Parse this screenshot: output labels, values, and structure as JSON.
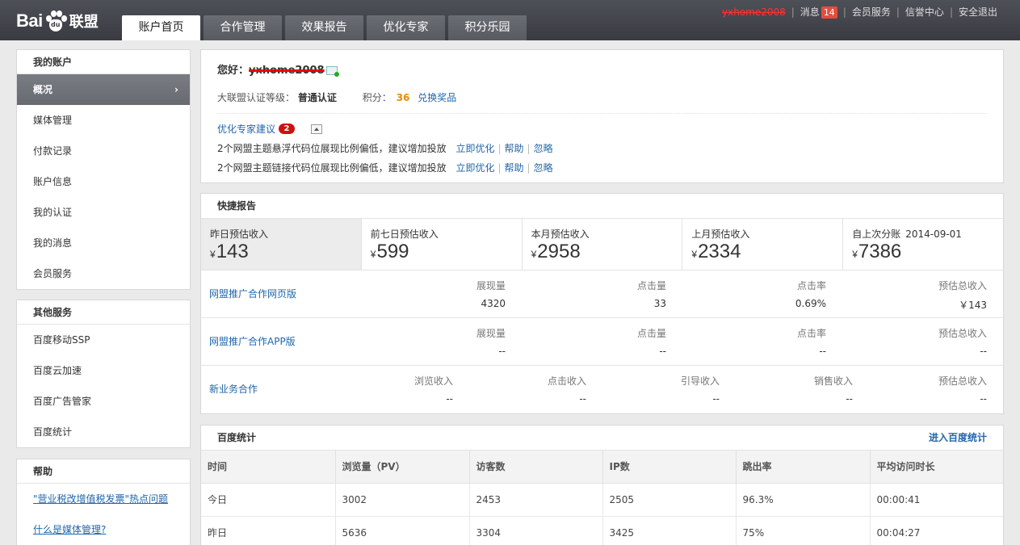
{
  "header": {
    "logo_bai": "Bai",
    "logo_du": "du",
    "logo_lianmeng": "联盟",
    "tabs": [
      {
        "label": "账户首页"
      },
      {
        "label": "合作管理"
      },
      {
        "label": "效果报告"
      },
      {
        "label": "优化专家"
      },
      {
        "label": "积分乐园"
      }
    ],
    "username": "yxhome2008",
    "messages_label": "消息",
    "messages_count": "14",
    "member_service": "会员服务",
    "credit_center": "信誉中心",
    "logout": "安全退出"
  },
  "sidebar": {
    "account": {
      "title": "我的账户",
      "items": [
        {
          "label": "概况"
        },
        {
          "label": "媒体管理"
        },
        {
          "label": "付款记录"
        },
        {
          "label": "账户信息"
        },
        {
          "label": "我的认证"
        },
        {
          "label": "我的消息"
        },
        {
          "label": "会员服务"
        }
      ]
    },
    "other": {
      "title": "其他服务",
      "items": [
        {
          "label": "百度移动SSP"
        },
        {
          "label": "百度云加速"
        },
        {
          "label": "百度广告管家"
        },
        {
          "label": "百度统计"
        }
      ]
    },
    "help": {
      "title": "帮助",
      "links": [
        {
          "label": "\"营业税改增值税发票\"热点问题"
        },
        {
          "label": "什么是媒体管理?"
        }
      ]
    }
  },
  "welcome": {
    "greeting": "您好：",
    "username": "yxhome2008",
    "cert_label": "大联盟认证等级：",
    "cert_value": "普通认证",
    "points_label": "积分：",
    "points_value": "36",
    "redeem": "兑换奖品",
    "advice_title": "优化专家建议",
    "advice_count": "2",
    "advice": [
      {
        "text": "2个网盟主题悬浮代码位展现比例偏低，建议增加投放",
        "action": "立即优化",
        "help": "帮助",
        "ignore": "忽略"
      },
      {
        "text": "2个网盟主题链接代码位展现比例偏低，建议增加投放",
        "action": "立即优化",
        "help": "帮助",
        "ignore": "忽略"
      }
    ]
  },
  "quick_report": {
    "title": "快捷报告",
    "currency": "¥",
    "stats": [
      {
        "label": "昨日预估收入",
        "value": "143",
        "date": ""
      },
      {
        "label": "前七日预估收入",
        "value": "599",
        "date": ""
      },
      {
        "label": "本月预估收入",
        "value": "2958",
        "date": ""
      },
      {
        "label": "上月预估收入",
        "value": "2334",
        "date": ""
      },
      {
        "label": "自上次分账",
        "value": "7386",
        "date": "2014-09-01"
      }
    ],
    "rows": [
      {
        "name": "网盟推广合作网页版",
        "cells": [
          {
            "h": "展现量",
            "v": "4320"
          },
          {
            "h": "点击量",
            "v": "33"
          },
          {
            "h": "点击率",
            "v": "0.69%"
          },
          {
            "h": "预估总收入",
            "v": "￥143"
          }
        ]
      },
      {
        "name": "网盟推广合作APP版",
        "cells": [
          {
            "h": "展现量",
            "v": "--"
          },
          {
            "h": "点击量",
            "v": "--"
          },
          {
            "h": "点击率",
            "v": "--"
          },
          {
            "h": "预估总收入",
            "v": "--"
          }
        ]
      },
      {
        "name": "新业务合作",
        "cells": [
          {
            "h": "浏览收入",
            "v": "--"
          },
          {
            "h": "点击收入",
            "v": "--"
          },
          {
            "h": "引导收入",
            "v": "--"
          },
          {
            "h": "销售收入",
            "v": "--"
          },
          {
            "h": "预估总收入",
            "v": "--"
          }
        ]
      }
    ]
  },
  "baidu_stats": {
    "title": "百度统计",
    "enter_link": "进入百度统计",
    "columns": [
      "时间",
      "浏览量（PV）",
      "访客数",
      "IP数",
      "跳出率",
      "平均访问时长"
    ],
    "rows": [
      [
        "今日",
        "3002",
        "2453",
        "2505",
        "96.3%",
        "00:00:41"
      ],
      [
        "昨日",
        "5636",
        "3304",
        "3425",
        "75%",
        "00:04:27"
      ]
    ]
  }
}
